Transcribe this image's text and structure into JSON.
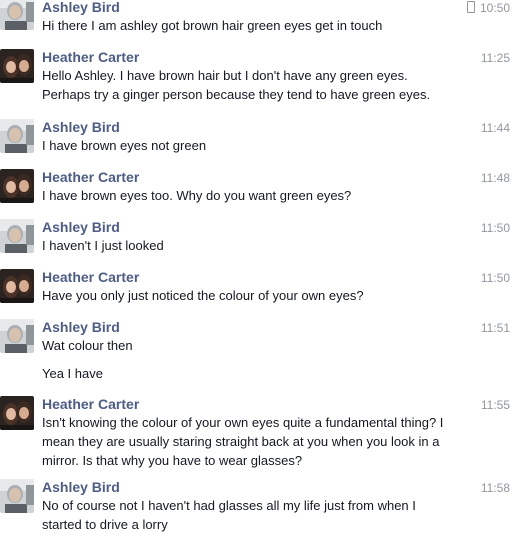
{
  "messages": [
    {
      "sender": "Ashley Bird",
      "time": "10:50",
      "mobile": true,
      "avatar": "ashley-avatar",
      "lines": [
        "Hi there I am ashley got brown hair green eyes get in touch"
      ]
    },
    {
      "sender": "Heather Carter",
      "time": "11:25",
      "avatar": "heather-avatar",
      "lines": [
        "Hello Ashley. I have brown hair but I don't have any green eyes.",
        "Perhaps try a ginger person because they tend to have green eyes."
      ]
    },
    {
      "sender": "Ashley Bird",
      "time": "11:44",
      "avatar": "ashley-avatar",
      "lines": [
        "I have brown eyes not green"
      ]
    },
    {
      "sender": "Heather Carter",
      "time": "11:48",
      "avatar": "heather-avatar",
      "lines": [
        "I have brown eyes too. Why do you want green eyes?"
      ]
    },
    {
      "sender": "Ashley Bird",
      "time": "11:50",
      "avatar": "ashley-avatar",
      "lines": [
        "I haven't  I just looked"
      ]
    },
    {
      "sender": "Heather Carter",
      "time": "11:50",
      "avatar": "heather-avatar",
      "lines": [
        "Have you only just noticed the colour of your own eyes?"
      ]
    },
    {
      "sender": "Ashley Bird",
      "time": "11:51",
      "avatar": "ashley-avatar",
      "lines": [
        "Wat colour then"
      ],
      "extra": [
        "Yea I have"
      ]
    },
    {
      "sender": "Heather Carter",
      "time": "11:55",
      "avatar": "heather-avatar",
      "lines": [
        "Isn't knowing the colour of your own eyes quite a fundamental thing? I",
        "mean they are usually staring straight back at you when you look in a",
        "mirror. Is that why you have to wear glasses?"
      ]
    },
    {
      "sender": "Ashley Bird",
      "time": "11:58",
      "avatar": "ashley-avatar",
      "lines": [
        "No of course not I haven't had glasses all my life just from when I",
        "started to drive a lorry"
      ]
    }
  ],
  "colors": {
    "name": "#4e5d86",
    "time": "#9197a3",
    "text": "#141823"
  }
}
